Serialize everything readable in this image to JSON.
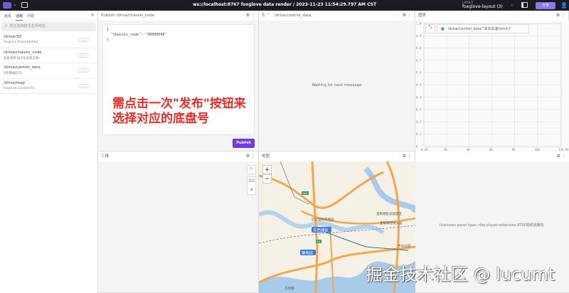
{
  "topbar": {
    "title": "ws://localhost:8767 foxglove data render / 2023-11-23 11:54:29.797 AM CST",
    "layout_label": "LAYOUT",
    "layout_name": "foxglove-layout (3)",
    "share_label": "分享"
  },
  "sidebar": {
    "tabs": [
      "面板",
      "话题",
      "问题"
    ],
    "active_tab": 1,
    "search_placeholder": "按主题或模式名称筛选...",
    "topics": [
      {
        "name": "/drive/3D",
        "schema": "foxglove.SceneUpdate"
      },
      {
        "name": "/drive/chassis_code",
        "schema": "底盘调用(电子化底盘交换)"
      },
      {
        "name": "/drive/control_data",
        "schema": "控制数据信号"
      },
      {
        "name": "/drive/map",
        "schema": "foxglove.LocationFix"
      }
    ]
  },
  "publish": {
    "title": "Publish /drive/chassis_code",
    "json": "{\n  \"chassis_code\": \"VD000049\"\n}",
    "note_line1": "需点击一次\"发布\"按钮来",
    "note_line2": "选择对应的底盘号",
    "button": "Publish"
  },
  "raw": {
    "topic": "/drive/control_data",
    "waiting": "Waiting for next message"
  },
  "plot": {
    "title": "图表",
    "legend": "/drive/control_data.\"本车车速(km/h)\""
  },
  "three_d": {
    "title": "三维",
    "tool_label": "3D"
  },
  "map": {
    "title": "地图",
    "zoom_in": "+",
    "zoom_out": "−",
    "labels": [
      "东西湖区",
      "蔡甸区",
      "武汉国际风情园",
      "金银湖生态旅游区",
      "金银湖湿地公园",
      "中山公园",
      "玉贤镇",
      "G42",
      "G4"
    ]
  },
  "unknown": {
    "message": "Unknown panel type: rtsp-player-extension.RTSP视频流播放."
  },
  "watermark": "掘金技术社区 @ lucumt",
  "chart_data": {
    "type": "line",
    "title": "图表",
    "series": [
      {
        "name": "/drive/control_data.\"本车车速(km/h)\"",
        "values": []
      }
    ],
    "xlim": [
      0,
      120.94
    ],
    "ylim": [
      0,
      1
    ],
    "xticks": [
      "0.00",
      "20",
      "40",
      "60",
      "80",
      "100",
      "120.94"
    ],
    "yticks": [
      "0",
      "0.1",
      "0.2",
      "0.3",
      "0.4",
      "0.5",
      "0.6",
      "0.7",
      "0.8",
      "0.9",
      "1.0"
    ],
    "grid": true,
    "legend": "top-left"
  }
}
